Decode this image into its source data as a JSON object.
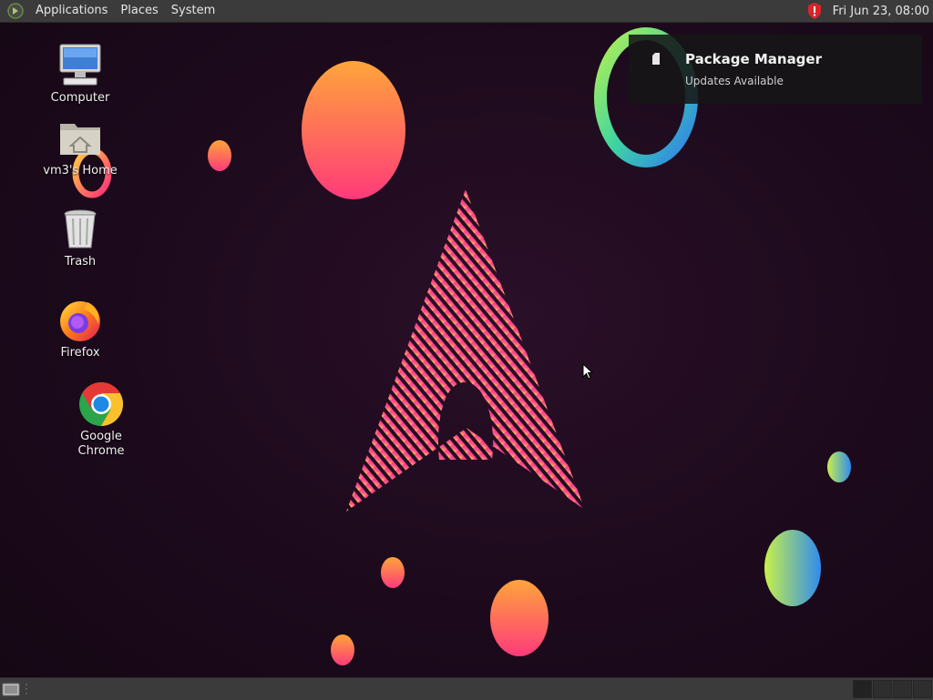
{
  "top_panel": {
    "menus": [
      "Applications",
      "Places",
      "System"
    ],
    "clock": "Fri Jun 23, 08:00",
    "tray_icon": "shield-alert-icon"
  },
  "desktop": {
    "icons": [
      {
        "label": "Computer",
        "icon": "computer-icon"
      },
      {
        "label": "vm3's Home",
        "icon": "home-folder-icon"
      },
      {
        "label": "Trash",
        "icon": "trash-icon"
      },
      {
        "label": "Firefox",
        "icon": "firefox-icon"
      },
      {
        "label": "Google Chrome",
        "icon": "chrome-icon"
      }
    ]
  },
  "notification": {
    "title": "Package Manager",
    "body": "Updates Available",
    "icon": "package-icon"
  },
  "bottom_panel": {
    "show_desktop_icon": "show-desktop-icon",
    "workspaces": 4
  },
  "colors": {
    "panel": "#3b3b3b",
    "background": "#1c0a1c",
    "accent_pink": "#ff2d8a",
    "accent_orange": "#ffa040"
  }
}
